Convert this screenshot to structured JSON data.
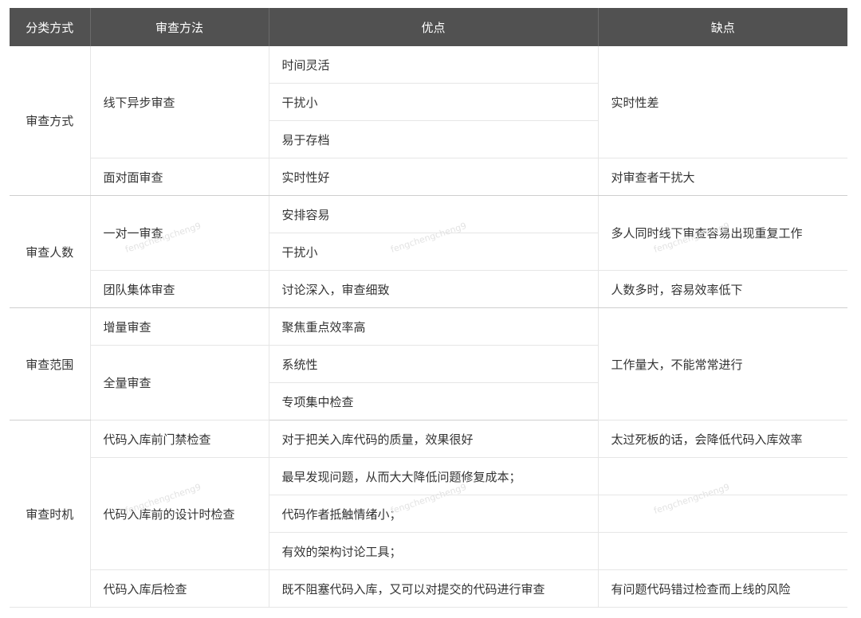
{
  "headers": [
    "分类方式",
    "审查方法",
    "优点",
    "缺点"
  ],
  "categories": [
    "审查方式",
    "审查人数",
    "审查范围",
    "审查时机"
  ],
  "methods": [
    "线下异步审查",
    "面对面审查",
    "一对一审查",
    "团队集体审查",
    "增量审查",
    "全量审查",
    "代码入库前门禁检查",
    "代码入库前的设计时检查",
    "代码入库后检查"
  ],
  "pros": [
    "时间灵活",
    "干扰小",
    "易于存档",
    "实时性好",
    "安排容易",
    "干扰小",
    "讨论深入，审查细致",
    "聚焦重点效率高",
    "系统性",
    "专项集中检查",
    "对于把关入库代码的质量，效果很好",
    "最早发现问题，从而大大降低问题修复成本；",
    "代码作者抵触情绪小；",
    "有效的架构讨论工具；",
    "既不阻塞代码入库，又可以对提交的代码进行审查"
  ],
  "cons": [
    "实时性差",
    "对审查者干扰大",
    "多人同时线下审查容易出现重复工作",
    "人数多时，容易效率低下",
    "工作量大，不能常常进行",
    "太过死板的话，会降低代码入库效率",
    "有问题代码错过检查而上线的风险"
  ],
  "watermark": "fengchengcheng9"
}
